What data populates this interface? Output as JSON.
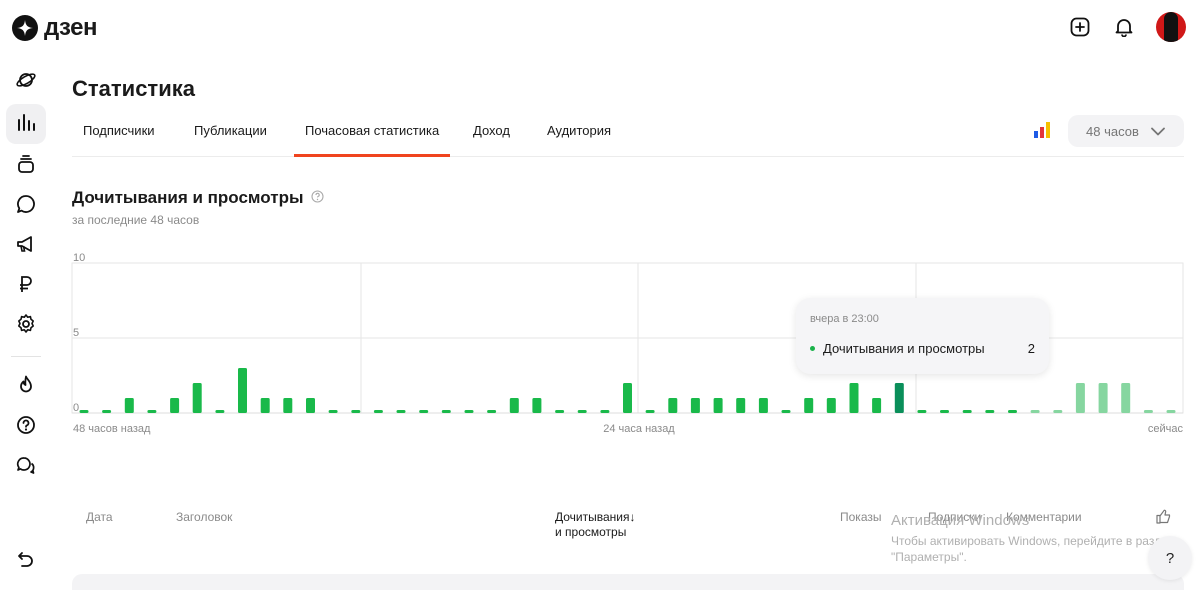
{
  "app": {
    "logo_text": "дзен"
  },
  "header": {
    "icons": [
      "add-icon",
      "bell-icon",
      "avatar"
    ]
  },
  "sidebar": {
    "items": [
      {
        "name": "feed",
        "icon": "planet-icon"
      },
      {
        "name": "statistics",
        "icon": "bar-chart-icon",
        "active": true
      },
      {
        "name": "publications",
        "icon": "stack-icon"
      },
      {
        "name": "comments",
        "icon": "chat-bubble-icon"
      },
      {
        "name": "promotion",
        "icon": "megaphone-icon"
      },
      {
        "name": "money",
        "icon": "ruble-icon"
      },
      {
        "name": "settings",
        "icon": "gear-icon"
      },
      {
        "name": "trending",
        "icon": "fire-icon"
      },
      {
        "name": "help",
        "icon": "question-icon"
      },
      {
        "name": "support",
        "icon": "messages-icon"
      }
    ],
    "back_icon": "undo-icon"
  },
  "page": {
    "title": "Статистика"
  },
  "tabs": [
    {
      "label": "Подписчики"
    },
    {
      "label": "Публикации"
    },
    {
      "label": "Почасовая статистика",
      "active": true
    },
    {
      "label": "Доход"
    },
    {
      "label": "Аудитория"
    }
  ],
  "period": {
    "value": "48 часов"
  },
  "section": {
    "title": "Дочитывания и просмотры",
    "subtitle": "за последние 48 часов"
  },
  "chart_data": {
    "type": "bar",
    "y_ticks": [
      "10",
      "5",
      "0"
    ],
    "ylim": [
      0,
      10
    ],
    "x_labels": [
      "48 часов назад",
      "24 часа назад",
      "сейчас"
    ],
    "grid": true,
    "colors": {
      "bar": "#19b94a",
      "highlight": "#0a8f5a",
      "light": "#86d6a0"
    },
    "values": [
      0.2,
      0.2,
      1,
      0.2,
      1,
      2,
      0.2,
      3,
      1,
      1,
      1,
      0.2,
      0.2,
      0.2,
      0.2,
      0.2,
      0.2,
      0.2,
      0.2,
      1,
      1,
      0.2,
      0.2,
      0.2,
      2,
      0.2,
      1,
      1,
      1,
      1,
      1,
      0.2,
      1,
      1,
      2,
      1,
      2,
      0.2,
      0.2,
      0.2,
      0.2,
      0.2,
      0.2,
      0.2,
      2,
      2,
      2,
      0.2,
      0.2
    ],
    "highlight_index": 36,
    "light_from_index": 42
  },
  "tooltip": {
    "time": "вчера в 23:00",
    "series": "Дочитывания и просмотры",
    "value": "2"
  },
  "table": {
    "columns": {
      "date": "Дата",
      "title": "Заголовок",
      "reads_line1": "Дочитывания↓",
      "reads_line2": "и просмотры",
      "impressions": "Показы",
      "subscriptions": "Подписки",
      "comments": "Комментарии",
      "likes_icon": "thumbs-up-icon"
    }
  },
  "overlay": {
    "activation_title": "Активация Windows",
    "activation_text_1": "Чтобы активировать Windows, перейдите в раздел",
    "activation_text_2": "\"Параметры\".",
    "help_label": "?"
  }
}
